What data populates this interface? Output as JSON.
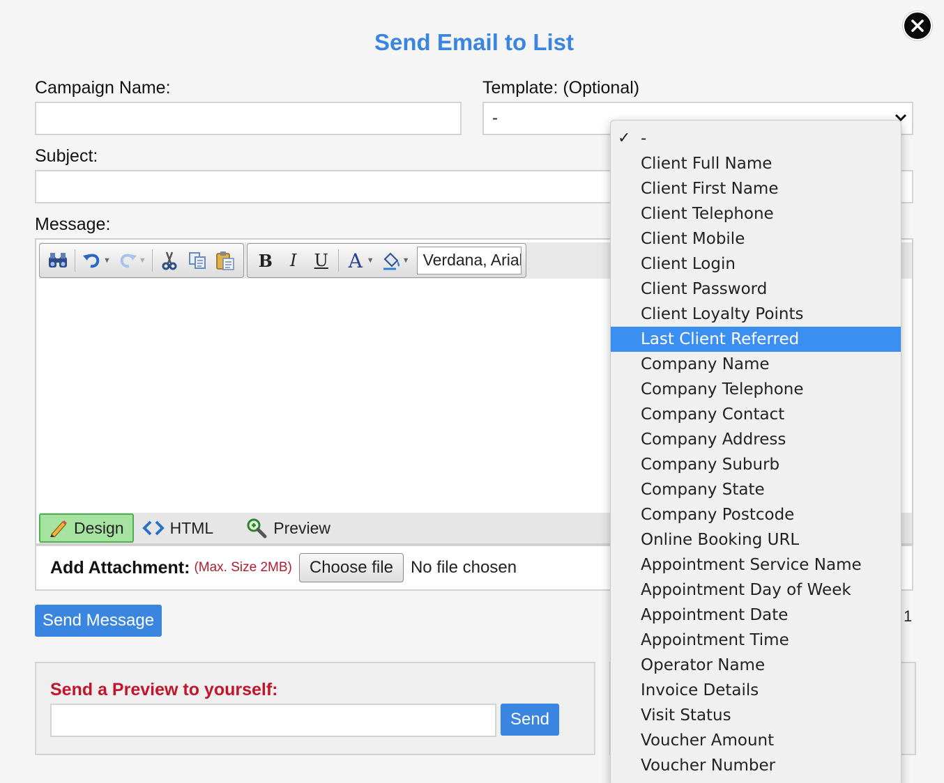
{
  "title": "Send Email to List",
  "campaign": {
    "label": "Campaign Name:",
    "value": ""
  },
  "template": {
    "label": "Template: (Optional)",
    "selected": "-",
    "options": [
      "-",
      "Client Full Name",
      "Client First Name",
      "Client Telephone",
      "Client Mobile",
      "Client Login",
      "Client Password",
      "Client Loyalty Points",
      "Last Client Referred",
      "Company Name",
      "Company Telephone",
      "Company Contact",
      "Company Address",
      "Company Suburb",
      "Company State",
      "Company Postcode",
      "Online Booking URL",
      "Appointment Service Name",
      "Appointment Day of Week",
      "Appointment Date",
      "Appointment Time",
      "Operator Name",
      "Invoice Details",
      "Visit Status",
      "Voucher Amount",
      "Voucher Number"
    ],
    "checked_index": 0,
    "highlighted_index": 8
  },
  "subject": {
    "label": "Subject:",
    "value": ""
  },
  "message": {
    "label": "Message:",
    "toolbar": {
      "bold": "B",
      "italic": "I",
      "underline": "U",
      "font_color": "A",
      "font_family": "Verdana, Arial"
    },
    "modes": {
      "design": "Design",
      "html": "HTML",
      "preview": "Preview",
      "active": "Design"
    }
  },
  "attachment": {
    "label": "Add Attachment:",
    "max_size": "(Max. Size 2MB)",
    "choose_button": "Choose file",
    "status": "No file chosen"
  },
  "send_message_button": "Send Message",
  "recipient_count": "1",
  "preview": {
    "title": "Send a Preview to yourself:",
    "value": "",
    "send_button": "Send"
  },
  "colors": {
    "accent": "#3a85e0",
    "danger": "#c0152c",
    "highlight": "#3b8ff0",
    "design_tab": "#a6e2a0"
  },
  "icons": {
    "close": "close-icon",
    "chevron": "chevron-down-icon",
    "check": "check-icon"
  }
}
